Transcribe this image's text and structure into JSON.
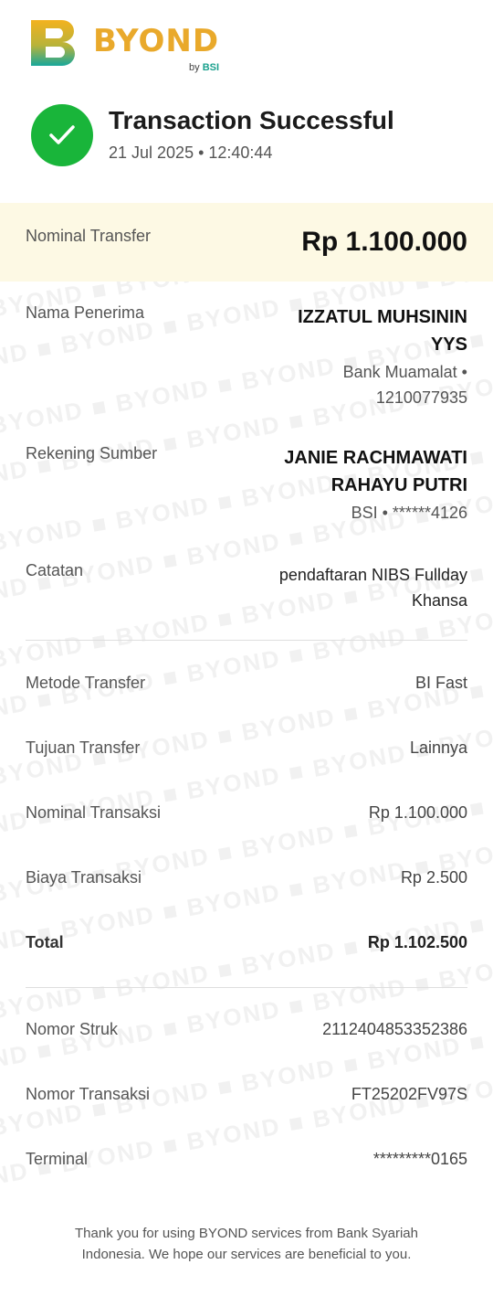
{
  "brand": {
    "name": "BYOND",
    "by_prefix": "by",
    "by_brand": "BSI",
    "watermark_text": "BYOND",
    "gradient_top": "#f3b21e",
    "gradient_bottom": "#17a79a",
    "accent": "#e9a92b"
  },
  "status": {
    "icon": "check-icon",
    "title": "Transaction Successful",
    "datetime": "21 Jul 2025 • 12:40:44",
    "color": "#19b53a"
  },
  "nominal": {
    "label": "Nominal Transfer",
    "value": "Rp 1.100.000"
  },
  "recipient": {
    "label": "Nama Penerima",
    "name_line1": "IZZATUL MUHSININ",
    "name_line2": "YYS",
    "bank_line1": "Bank Muamalat •",
    "bank_line2": "1210077935"
  },
  "source": {
    "label": "Rekening Sumber",
    "name_line1": "JANIE RACHMAWATI",
    "name_line2": "RAHAYU PUTRI",
    "account": "BSI • ******4126"
  },
  "note": {
    "label": "Catatan",
    "line1": "pendaftaran NIBS Fullday",
    "line2": "Khansa"
  },
  "details": [
    {
      "label": "Metode Transfer",
      "value": "BI Fast"
    },
    {
      "label": "Tujuan Transfer",
      "value": "Lainnya"
    },
    {
      "label": "Nominal Transaksi",
      "value": "Rp 1.100.000"
    },
    {
      "label": "Biaya Transaksi",
      "value": "Rp 2.500"
    },
    {
      "label": "Total",
      "value": "Rp 1.102.500"
    }
  ],
  "references": [
    {
      "label": "Nomor Struk",
      "value": "2112404853352386"
    },
    {
      "label": "Nomor Transaksi",
      "value": "FT25202FV97S"
    },
    {
      "label": "Terminal",
      "value": "*********0165"
    }
  ],
  "footer": {
    "line1": "Thank you for using BYOND services from Bank Syariah",
    "line2": "Indonesia. We hope our services are beneficial to you."
  }
}
